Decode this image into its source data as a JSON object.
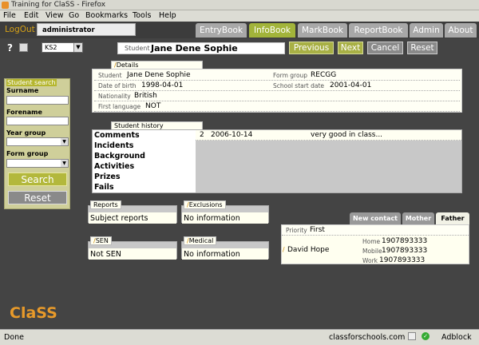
{
  "window": {
    "title": "Training for ClaSS - Firefox"
  },
  "menu": {
    "items": [
      "File",
      "Edit",
      "View",
      "Go",
      "Bookmarks",
      "Tools",
      "Help"
    ]
  },
  "header": {
    "logout": "LogOut",
    "username": "administrator",
    "tabs": [
      "EntryBook",
      "InfoBook",
      "MarkBook",
      "ReportBook",
      "Admin",
      "About"
    ],
    "active_tab": "InfoBook"
  },
  "toolbar": {
    "help_icon": "?",
    "print_icon": "print-icon",
    "keystage": "KS2",
    "student_label": "Student",
    "student_name": "Jane Dene Sophie",
    "previous": "Previous",
    "next": "Next",
    "cancel": "Cancel",
    "reset": "Reset"
  },
  "search": {
    "title": "Student search",
    "surname_label": "Surname",
    "forename_label": "Forename",
    "year_label": "Year group",
    "form_label": "Form group",
    "search_button": "Search",
    "reset_button": "Reset"
  },
  "details": {
    "legend": "Details",
    "student_label": "Student",
    "student_value": "Jane Dene Sophie",
    "form_group_label": "Form group",
    "form_group_value": "RECGG",
    "dob_label": "Date of birth",
    "dob_value": "1998-04-01",
    "school_start_label": "School start date",
    "school_start_value": "2001-04-01",
    "nationality_label": "Nationality",
    "nationality_value": "British",
    "first_language_label": "First language",
    "first_language_value": "NOT"
  },
  "history": {
    "legend": "Student history",
    "items": [
      "Comments",
      "Incidents",
      "Background",
      "Activities",
      "Prizes",
      "Fails"
    ],
    "entry": {
      "count": "2",
      "date": "2006-10-14",
      "text": "very good in class..."
    }
  },
  "boxes": {
    "reports_legend": "Reports",
    "reports_value": "Subject reports",
    "exclusions_legend": "Exclusions",
    "exclusions_value": "No information",
    "sen_legend": "SEN",
    "sen_value": "Not SEN",
    "medical_legend": "Medical",
    "medical_value": "No information"
  },
  "contacts": {
    "tabs": [
      "New contact",
      "Mother",
      "Father"
    ],
    "active_tab": "Father",
    "priority_label": "Priority",
    "priority_value": "First",
    "name": "David Hope",
    "home_label": "Home",
    "home_value": "1907893333",
    "mobile_label": "Mobile",
    "mobile_value": "1907893333",
    "work_label": "Work",
    "work_value": "1907893333"
  },
  "logo": {
    "text": "ClaSS"
  },
  "status": {
    "left": "Done",
    "domain": "classforschools.com",
    "adblock": "Adblock"
  },
  "colors": {
    "accent": "#a2b43a",
    "logo": "#e89a2a",
    "background": "#444444"
  }
}
